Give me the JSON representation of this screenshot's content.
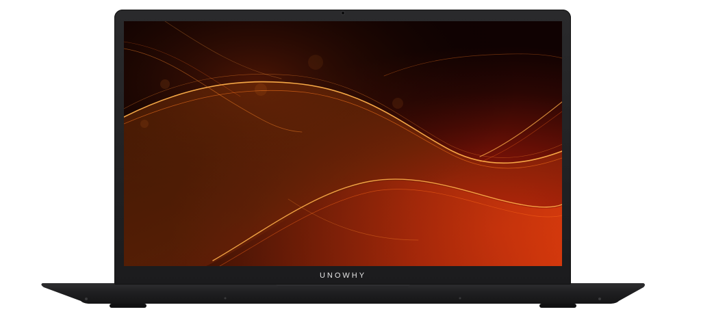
{
  "device": {
    "brand_label": "UNOWHY"
  },
  "icons": {
    "webcam": "webcam-icon"
  },
  "colors": {
    "bezel": "#1e1e20",
    "wallpaper_base": "#120303",
    "wave_accent": "#ff6a1a",
    "wave_red": "#d8200a",
    "background": "#ffffff"
  }
}
